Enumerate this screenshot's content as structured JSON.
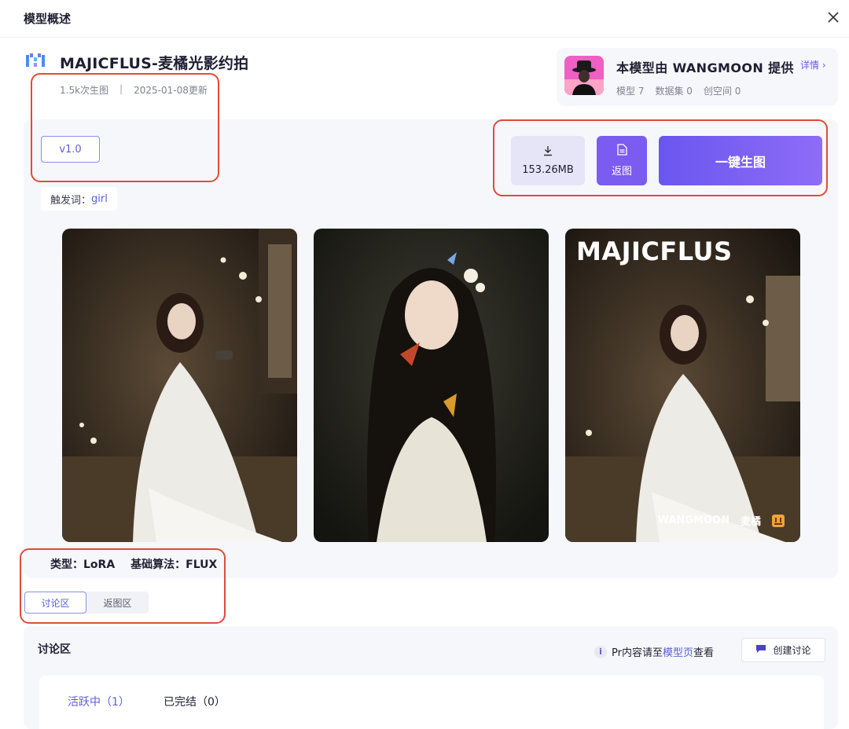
{
  "modal": {
    "title": "模型概述"
  },
  "model": {
    "name": "MAJICFLUS-麦橘光影约拍",
    "uses": "1.5k次生图",
    "updated": "2025-01-08更新",
    "version": "v1.0",
    "trigger_label": "触发词：",
    "trigger_word": "girl",
    "type_label": "类型：LoRA",
    "algo_label": "基础算法：FLUX"
  },
  "author": {
    "title": "本模型由 WANGMOON 提供",
    "detail_link": "详情",
    "stats": [
      "模型 7",
      "数据集 0",
      "创空间 0"
    ]
  },
  "actions": {
    "download_size": "153.26MB",
    "return_label": "返图",
    "generate_label": "一键生图"
  },
  "gallery": {
    "watermark_title": "MAJICFLUS",
    "watermark_author": "WANGMOON",
    "watermark_brand": "麦橘"
  },
  "tabs": {
    "discuss": "讨论区",
    "returns": "返图区"
  },
  "discussion": {
    "title": "讨论区",
    "note_prefix": "Pr内容请至",
    "note_link": "模型页",
    "note_suffix": "查看",
    "create_label": "创建讨论",
    "active_tab": "活跃中（1）",
    "closed_tab": "已完结（0）"
  },
  "colors": {
    "accent": "#6a56ef",
    "highlight": "#e04b3a"
  }
}
